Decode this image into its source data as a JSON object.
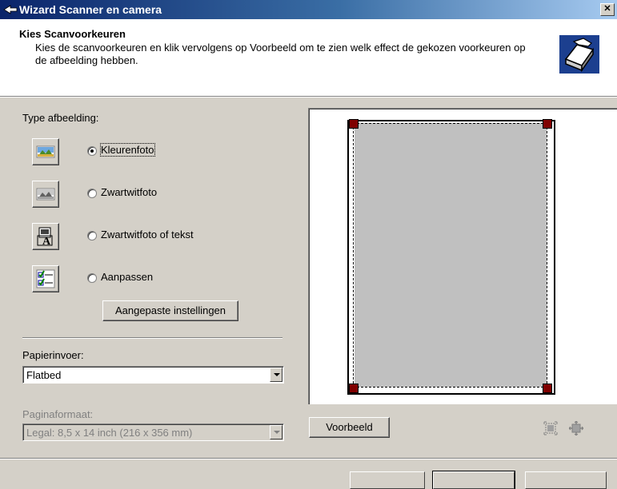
{
  "window": {
    "title": "Wizard Scanner en camera",
    "close_label": "✕"
  },
  "header": {
    "title": "Kies Scanvoorkeuren",
    "subtitle": "Kies de scanvoorkeuren en klik vervolgens op Voorbeeld om te zien welk effect de gekozen voorkeuren op de afbeelding hebben."
  },
  "image_type": {
    "label": "Type afbeelding:",
    "options": [
      {
        "label": "Kleurenfoto",
        "selected": true,
        "icon": "color-photo-icon"
      },
      {
        "label": "Zwartwitfoto",
        "selected": false,
        "icon": "grayscale-photo-icon"
      },
      {
        "label": "Zwartwitfoto of tekst",
        "selected": false,
        "icon": "bw-text-icon"
      },
      {
        "label": "Aanpassen",
        "selected": false,
        "icon": "custom-settings-icon"
      }
    ],
    "custom_settings_button": "Aangepaste instellingen"
  },
  "paper_source": {
    "label": "Papierinvoer:",
    "value": "Flatbed"
  },
  "page_size": {
    "label": "Paginaformaat:",
    "value": "Legal: 8,5 x 14 inch (216 x 356 mm)",
    "enabled": false
  },
  "preview": {
    "button": "Voorbeeld",
    "tools": [
      "fit-selection-icon",
      "zoom-to-selection-icon"
    ]
  },
  "colors": {
    "titlebar_start": "#0a246a",
    "titlebar_end": "#a6caf0",
    "dialog_face": "#d4d0c8",
    "scan_area": "#c0c0c0",
    "crop_handle": "#800000"
  }
}
